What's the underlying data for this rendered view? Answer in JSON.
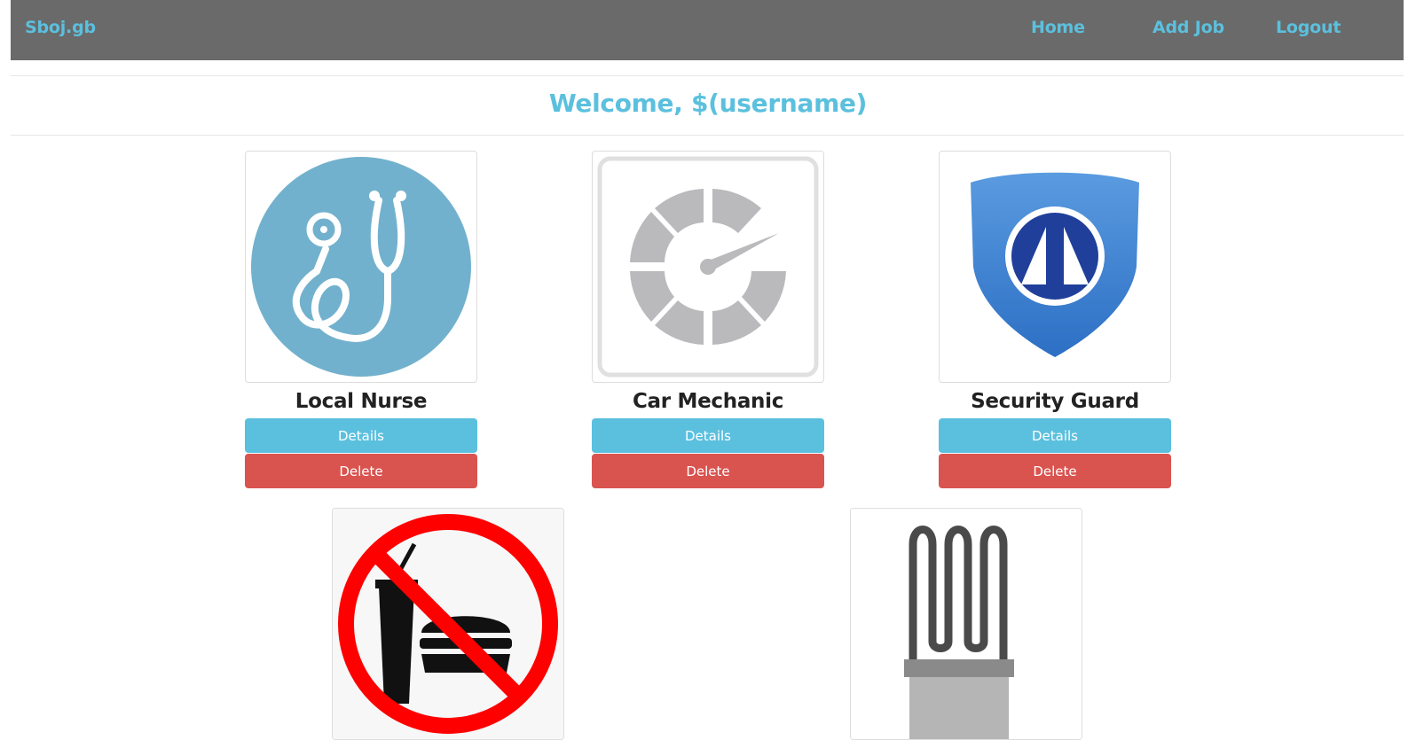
{
  "navbar": {
    "brand": "Sboj.gb",
    "links": [
      {
        "label": "Home"
      },
      {
        "label": "Add Job"
      },
      {
        "label": "Logout"
      }
    ]
  },
  "welcome": "Welcome, $(username)",
  "jobs": [
    {
      "title": "Local Nurse",
      "icon": "stethoscope-icon",
      "details_label": "Details",
      "delete_label": "Delete"
    },
    {
      "title": "Car Mechanic",
      "icon": "speedometer-icon",
      "details_label": "Details",
      "delete_label": "Delete"
    },
    {
      "title": "Security Guard",
      "icon": "shield-icon",
      "details_label": "Details",
      "delete_label": "Delete"
    },
    {
      "title": "",
      "icon": "no-food-sign-icon"
    },
    {
      "title": "",
      "icon": "heating-element-icon"
    }
  ],
  "colors": {
    "navbar_bg": "#6a6a6a",
    "accent": "#5bc0de",
    "danger": "#d9534f"
  }
}
